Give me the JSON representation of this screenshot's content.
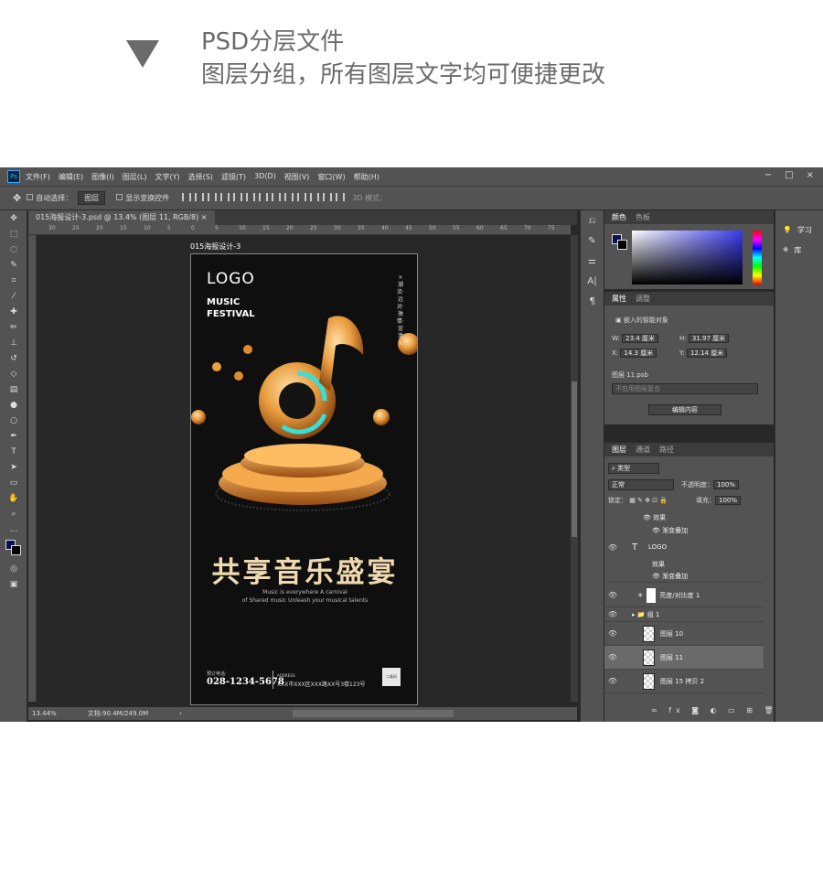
{
  "caption": {
    "line1": "PSD分层文件",
    "line2": "图层分组，所有图层文字均可便捷更改"
  },
  "menubar": {
    "logo": "Ps",
    "items": [
      "文件(F)",
      "编辑(E)",
      "图像(I)",
      "图层(L)",
      "文字(Y)",
      "选择(S)",
      "滤镜(T)",
      "3D(D)",
      "视图(V)",
      "窗口(W)",
      "帮助(H)"
    ],
    "controls": [
      "−",
      "□",
      "×"
    ]
  },
  "options": {
    "auto_select": "自动选择：",
    "layer_dropdown": "图层",
    "show_transform": "显示变换控件",
    "mode_3d": "3D 模式："
  },
  "document": {
    "tab_title": "015海报设计-3.psd @ 13.4% (图层 11, RGB/8)",
    "artboard": "015海报设计-3",
    "ruler": [
      "30",
      "25",
      "20",
      "15",
      "10",
      "5",
      "0",
      "5",
      "10",
      "15",
      "20",
      "25",
      "30",
      "35",
      "40",
      "45",
      "50",
      "55",
      "60",
      "65",
      "70",
      "75"
    ]
  },
  "poster": {
    "logo": "LOGO",
    "festival": "MUSIC\nFESTIVAL",
    "vertical": "×潮流·远对·激情·宣泄×",
    "headline": "共享音乐盛宴",
    "subline": "Music is everywhere A carnival\nof Shared music Unleash your musical talents",
    "tel_label": "预订电话:",
    "tel": "028-1234-5678",
    "addr_label": "ADDRESS:",
    "addr": "XXX市XXX区XXX路XX号3楼123号",
    "qr": "二维码"
  },
  "status": {
    "zoom": "13.44%",
    "doc": "文档:90.4M/249.0M"
  },
  "color_panel": {
    "tabs": [
      "颜色",
      "色板"
    ]
  },
  "properties_panel": {
    "tabs": [
      "属性",
      "调整"
    ],
    "type": "嵌入的智能对象",
    "w_label": "W:",
    "w": "23.4 厘米",
    "h_label": "H:",
    "h": "31.97 厘米",
    "x_label": "X:",
    "x": "14.3 厘米",
    "y_label": "Y:",
    "y": "12.14 厘米",
    "layer_name": "图层 11.psb",
    "comp": "不应用图层复合",
    "edit_button": "编辑内容"
  },
  "layers_panel": {
    "tabs": [
      "图层",
      "通道",
      "路径"
    ],
    "filter": "类型",
    "blend": "正常",
    "opacity_label": "不透明度：",
    "opacity": "100%",
    "lock_label": "锁定：",
    "fill_label": "填充：",
    "fill": "100%",
    "rows": [
      {
        "name": "效果"
      },
      {
        "name": "渐变叠加"
      },
      {
        "name": "LOGO"
      },
      {
        "name": "效果"
      },
      {
        "name": "渐变叠加"
      },
      {
        "name": "亮度/对比度 1"
      },
      {
        "name": "组 1"
      },
      {
        "name": "图层 10"
      },
      {
        "name": "图层 11"
      },
      {
        "name": "图层 15 拷贝 2"
      }
    ]
  },
  "right_strip": {
    "learn": "学习",
    "library": "库"
  }
}
